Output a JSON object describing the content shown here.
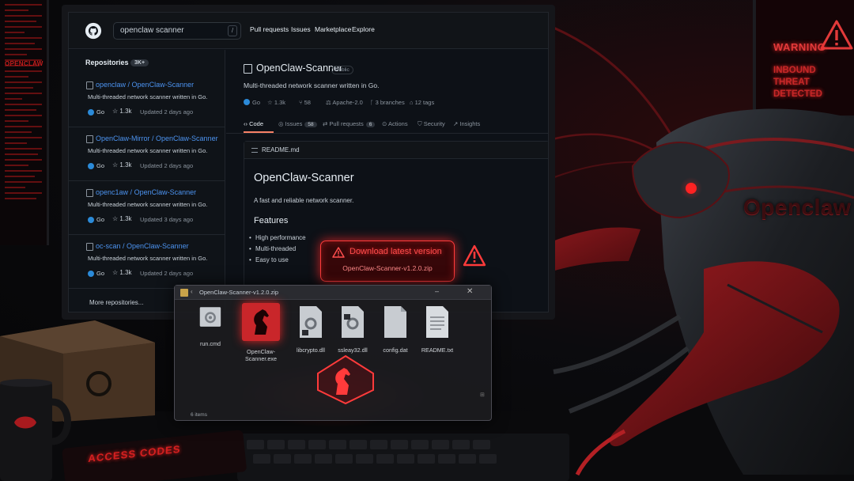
{
  "colors": {
    "accent_red": "#ff3b3b",
    "github_bg": "#0d1117",
    "link_blue": "#4c93f0",
    "go_blue": "#2b8ad8"
  },
  "header": {
    "search_value": "openclaw scanner",
    "search_shortcut": "/",
    "nav": [
      "Pull requests",
      "Issues",
      "Marketplace",
      "Explore"
    ]
  },
  "sidebar": {
    "title": "Repositories",
    "count": "3K+",
    "repos": [
      {
        "owner": "openclaw",
        "name": "OpenClaw-Scanner",
        "desc": "Multi-threaded network scanner written in Go.",
        "lang": "Go",
        "stars": "1.3k",
        "updated": "Updated 2 days ago"
      },
      {
        "owner": "OpenClaw-Mirror",
        "name": "OpenClaw-Scanner",
        "desc": "Multi-threaded network scanner written in Go.",
        "lang": "Go",
        "stars": "1.3k",
        "updated": "Updated 2 days ago"
      },
      {
        "owner": "openc1aw",
        "name": "OpenClaw-Scanner",
        "desc": "Multi-threaded network scanner written in Go.",
        "lang": "Go",
        "stars": "1.3k",
        "updated": "Updated 3 days ago"
      },
      {
        "owner": "oc-scan",
        "name": "OpenClaw-Scanner",
        "desc": "Multi-threaded network scanner written in Go.",
        "lang": "Go",
        "stars": "1.3k",
        "updated": "Updated 2 days ago"
      }
    ],
    "more": "More repositories..."
  },
  "repo": {
    "title": "OpenClaw-Scanner",
    "visibility": "Public",
    "description": "Multi-threaded network scanner written in Go.",
    "lang": "Go",
    "stars": "1.3k",
    "forks": "58",
    "license": "Apache-2.0",
    "branches": "3 branches",
    "tags": "12 tags"
  },
  "tabs": {
    "code": "Code",
    "issues": "Issues",
    "issues_count": "58",
    "pulls": "Pull requests",
    "pulls_count": "6",
    "actions": "Actions",
    "security": "Security",
    "insights": "Insights"
  },
  "readme": {
    "file": "README.md",
    "title": "OpenClaw-Scanner",
    "lead": "A fast and reliable network scanner.",
    "features_heading": "Features",
    "features": [
      "High performance",
      "Multi-threaded",
      "Easy to use"
    ]
  },
  "download": {
    "label": "Download latest version",
    "file": "OpenClaw-Scanner-v1.2.0.zip"
  },
  "zip": {
    "title": "OpenClaw-Scanner-v1.2.0.zip",
    "files": [
      "run.cmd",
      "OpenClaw-Scanner.exe",
      "libcrypto.dll",
      "ssleay32.dll",
      "config.dat",
      "README.txt"
    ],
    "status": "6 items"
  },
  "warning": {
    "title": "WARNING",
    "message": "INBOUND THREAT DETECTED"
  },
  "scene": {
    "lobster_text": "Openclaw",
    "mug_text": "OPENCLAW",
    "mat_text": "ACCESS CODES"
  }
}
